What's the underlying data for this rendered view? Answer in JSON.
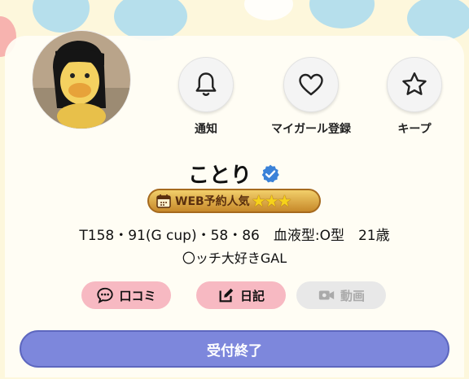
{
  "profile": {
    "name": "ことり",
    "badge_text": "WEB予約人気",
    "badge_stars": "★★★",
    "stats": "T158・91(G cup)・58・86　血液型:O型　21歳",
    "catchphrase": "〇ッチ大好きGAL"
  },
  "actions": [
    {
      "label": "通知",
      "icon": "bell-icon"
    },
    {
      "label": "マイガール登録",
      "icon": "heart-icon"
    },
    {
      "label": "キープ",
      "icon": "star-icon"
    }
  ],
  "tabs": [
    {
      "label": "口コミ",
      "icon": "chat-bubble-icon",
      "enabled": true
    },
    {
      "label": "日記",
      "icon": "edit-icon",
      "enabled": true
    },
    {
      "label": "動画",
      "icon": "video-camera-icon",
      "enabled": false
    }
  ],
  "cta": {
    "label": "受付終了"
  },
  "colors": {
    "background": "#fdf7dc",
    "pill_pink": "#f7b9c2",
    "cta": "#7d87dc",
    "verified": "#3b82d8",
    "badge_gold": "#d9a441"
  }
}
